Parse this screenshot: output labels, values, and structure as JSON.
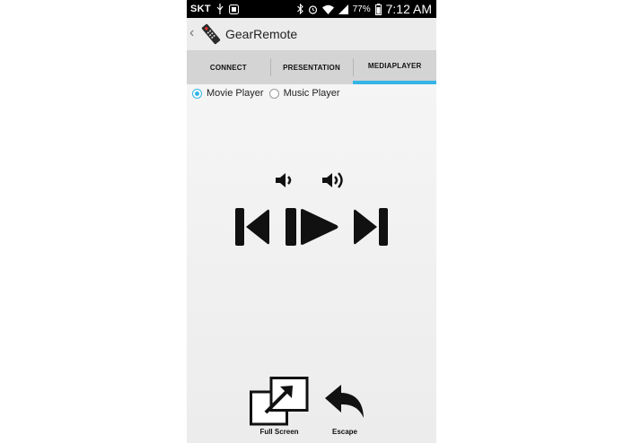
{
  "status_bar": {
    "carrier": "SKT",
    "battery_percent": "77%",
    "time": "7:12 AM",
    "icons": [
      "usb-icon",
      "gallery-icon",
      "bluetooth-icon",
      "alarm-icon",
      "wifi-icon",
      "signal-icon",
      "battery-icon"
    ]
  },
  "action_bar": {
    "title": "GearRemote",
    "logo_icon": "remote-control-icon"
  },
  "tabs": [
    {
      "label": "CONNECT",
      "active": false
    },
    {
      "label": "PRESENTATION",
      "active": false
    },
    {
      "label": "MEDIAPLAYER",
      "active": true
    }
  ],
  "player_mode": {
    "options": [
      {
        "label": "Movie Player",
        "checked": true
      },
      {
        "label": "Music Player",
        "checked": false
      }
    ]
  },
  "controls": {
    "volume_down_icon": "volume-down-icon",
    "volume_up_icon": "volume-up-icon",
    "previous_icon": "skip-previous-icon",
    "play_pause_icon": "play-pause-icon",
    "next_icon": "skip-next-icon"
  },
  "bottom_actions": {
    "full_screen_label": "Full Screen",
    "escape_label": "Escape"
  },
  "colors": {
    "accent": "#33b5e5",
    "tab_bar": "#d4d4d4",
    "status_bar": "#000000"
  }
}
